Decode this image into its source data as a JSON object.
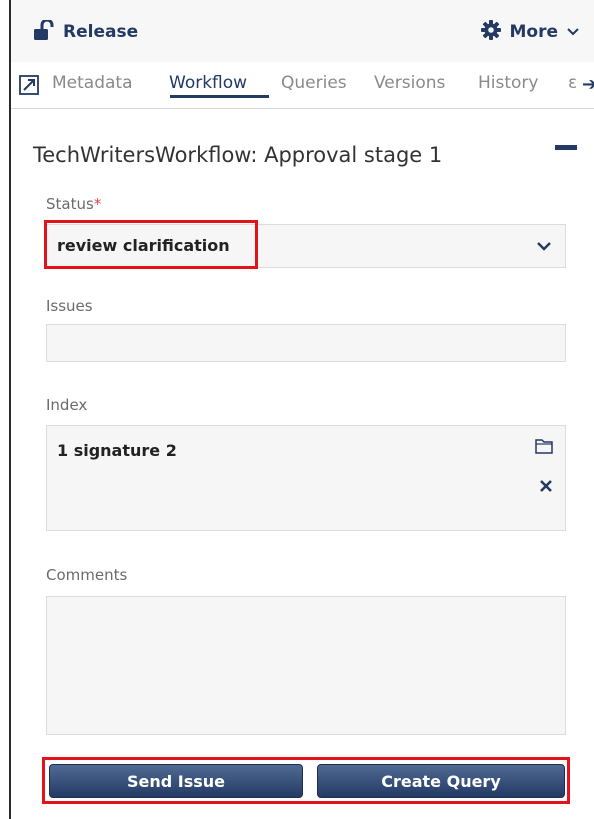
{
  "topbar": {
    "release_label": "Release",
    "more_label": "More"
  },
  "tabs": [
    {
      "label": "Metadata",
      "active": false
    },
    {
      "label": "Workflow",
      "active": true
    },
    {
      "label": "Queries",
      "active": false
    },
    {
      "label": "Versions",
      "active": false
    },
    {
      "label": "History",
      "active": false
    }
  ],
  "tabs_overflow_text": "ε",
  "workflow": {
    "title": "TechWritersWorkflow: Approval stage 1",
    "status": {
      "label": "Status",
      "required_marker": "*",
      "value": "review clarification"
    },
    "issues": {
      "label": "Issues",
      "value": ""
    },
    "index": {
      "label": "Index",
      "value": "1 signature 2"
    },
    "comments": {
      "label": "Comments",
      "value": ""
    }
  },
  "actions": {
    "send_issue_label": "Send Issue",
    "create_query_label": "Create Query"
  },
  "colors": {
    "brand": "#233a64",
    "highlight": "#e3121b",
    "required": "#d84a4a"
  },
  "icons": {
    "release": "unlock-icon",
    "more": "gear-icon",
    "expand": "expand-icon",
    "next_tabs": "arrow-right-icon",
    "collapse": "minus-icon",
    "dropdown": "chevron-down-icon",
    "folder": "folder-icon",
    "remove": "close-icon"
  }
}
